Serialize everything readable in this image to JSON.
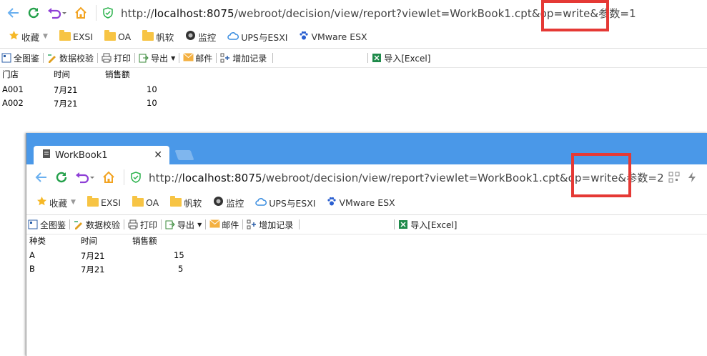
{
  "back": {
    "url_prefix": "http://",
    "url_host": "localhost:8075",
    "url_rest": "/webroot/decision/view/report?viewlet=WorkBook1.cpt&op=write&参数=1",
    "bookmarks": [
      {
        "label": "收藏",
        "icon": "star-icon",
        "dropdown": true
      },
      {
        "label": "EXSI",
        "icon": "folder-icon"
      },
      {
        "label": "OA",
        "icon": "folder-icon"
      },
      {
        "label": "帆软",
        "icon": "folder-icon"
      },
      {
        "label": "监控",
        "icon": "camera-icon"
      },
      {
        "label": "UPS与ESXI",
        "icon": "cloud-icon"
      },
      {
        "label": "VMware ESX",
        "icon": "paw-icon"
      }
    ],
    "toolbar": [
      "全图鉴",
      "数据校验",
      "打印",
      "导出",
      "邮件",
      "增加记录",
      "导入[Excel]"
    ],
    "table": {
      "headers": [
        "门店",
        "时间",
        "销售额"
      ],
      "rows": [
        [
          "A001",
          "7月21",
          "10"
        ],
        [
          "A002",
          "7月21",
          "10"
        ]
      ]
    }
  },
  "front": {
    "tab_title": "WorkBook1",
    "url_prefix": "http://",
    "url_host": "localhost:8075",
    "url_rest": "/webroot/decision/view/report?viewlet=WorkBook1.cpt&op=write&参数=2",
    "bookmarks": [
      {
        "label": "收藏",
        "icon": "star-icon",
        "dropdown": true
      },
      {
        "label": "EXSI",
        "icon": "folder-icon"
      },
      {
        "label": "OA",
        "icon": "folder-icon"
      },
      {
        "label": "帆软",
        "icon": "folder-icon"
      },
      {
        "label": "监控",
        "icon": "camera-icon"
      },
      {
        "label": "UPS与ESXI",
        "icon": "cloud-icon"
      },
      {
        "label": "VMware ESX",
        "icon": "paw-icon"
      }
    ],
    "toolbar": [
      "全图鉴",
      "数据校验",
      "打印",
      "导出",
      "邮件",
      "增加记录",
      "导入[Excel]"
    ],
    "table": {
      "headers": [
        "种类",
        "时间",
        "销售额"
      ],
      "rows": [
        [
          "A",
          "7月21",
          "15"
        ],
        [
          "B",
          "7月21",
          "5"
        ]
      ]
    }
  },
  "colors": {
    "highlight": "#e53935",
    "tabstrip": "#4a98e8"
  }
}
